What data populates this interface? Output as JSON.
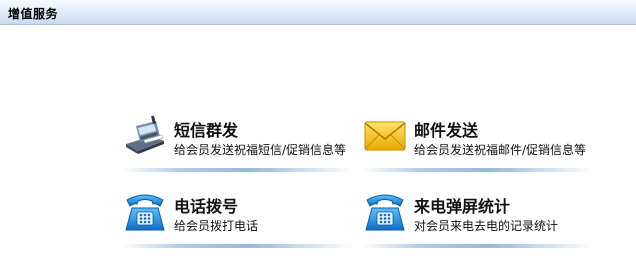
{
  "header": {
    "title": "增值服务"
  },
  "services": [
    {
      "name": "短信群发",
      "description": "给会员发送祝福短信/促销信息等",
      "icon": "sms-phone-icon"
    },
    {
      "name": "邮件发送",
      "description": "给会员发送祝福邮件/促销信息等",
      "icon": "envelope-icon"
    },
    {
      "name": "电话拨号",
      "description": "给会员拨打电话",
      "icon": "telephone-icon"
    },
    {
      "name": "来电弹屏统计",
      "description": "对会员来电去电的记录统计",
      "icon": "telephone-icon"
    }
  ],
  "colors": {
    "header_gradient_top": "#f7faff",
    "header_gradient_bottom": "#c9d9ee",
    "phone_blue": "#1e88d8",
    "envelope_yellow": "#f5c21a"
  }
}
